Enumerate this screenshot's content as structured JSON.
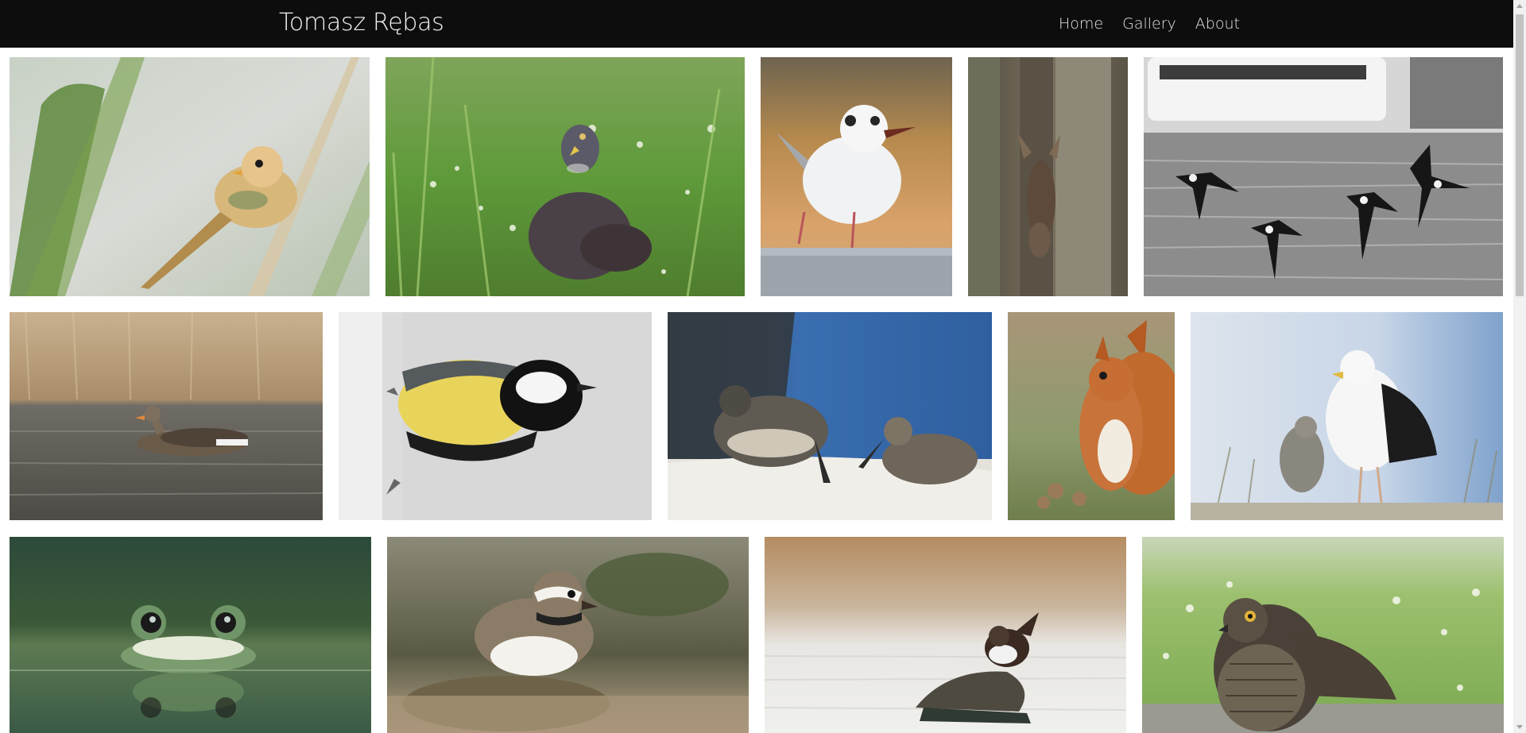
{
  "header": {
    "brand": "Tomasz Rębas",
    "nav": [
      {
        "label": "Home"
      },
      {
        "label": "Gallery"
      },
      {
        "label": "About"
      }
    ]
  },
  "gallery": {
    "photos": [
      {
        "subject": "bearded reedling on reed"
      },
      {
        "subject": "wood pigeon in grass"
      },
      {
        "subject": "black-headed gull"
      },
      {
        "subject": "moose behind tree"
      },
      {
        "subject": "razorbills flying over water"
      },
      {
        "subject": "greylag goose swimming"
      },
      {
        "subject": "great tit on tree trunk"
      },
      {
        "subject": "sandpipers on shore"
      },
      {
        "subject": "red squirrel"
      },
      {
        "subject": "great black-backed gull with chick"
      },
      {
        "subject": "frog in water"
      },
      {
        "subject": "ringed plover"
      },
      {
        "subject": "dipper on stone"
      },
      {
        "subject": "sparrowhawk"
      }
    ]
  },
  "colors": {
    "navbar": "#0d0d0d",
    "brand_text": "#f2f2f2",
    "nav_text": "#e6e6e6"
  }
}
